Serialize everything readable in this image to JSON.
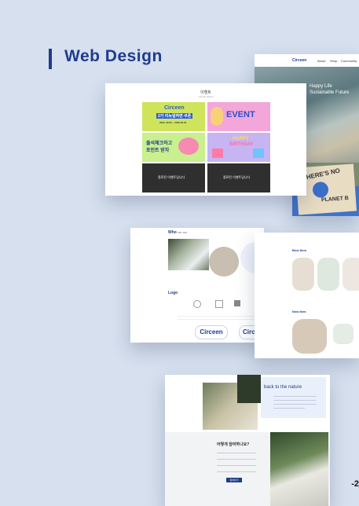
{
  "header": {
    "title": "Web Design"
  },
  "event_board": {
    "title": "이벤트",
    "subtitle": "Circeen Event",
    "tiles": [
      {
        "main": "Circeen",
        "line1": "2가 리뉴얼하면 쿠폰",
        "line2": "2022. 08.00 ~ 0000.00.00"
      },
      {
        "main": "EVENT",
        "line1": "",
        "line2": ""
      },
      {
        "main": "출석체크하고",
        "line1": "포인트 받자",
        "line2": ""
      },
      {
        "main": "HAPPY",
        "line1": "BIRTHDAY",
        "line2": ""
      },
      {
        "main": "종료된 이벤트입니다",
        "line1": "",
        "line2": ""
      },
      {
        "main": "종료된 이벤트입니다",
        "line1": "",
        "line2": ""
      }
    ]
  },
  "hero": {
    "nav_logo": "Circeen",
    "nav_items": [
      "About",
      "Shop",
      "Community"
    ],
    "text_lines": [
      "Happy Life",
      "Sustainable Future"
    ]
  },
  "who": {
    "heading": "Who",
    "heading_suffix": "we are",
    "logo_heading": "Logo",
    "logo_text": "Circeen",
    "steps": [
      "",
      "",
      "",
      ""
    ]
  },
  "poster": {
    "line1": "THERE'S NO",
    "line2": "PLANET B"
  },
  "bestnew": {
    "best_label": "Best Item",
    "new_label": "New Item"
  },
  "nature": {
    "heading": "back to the nature",
    "question": "어떻게 참여하나요?",
    "button": "참여하기"
  },
  "page": {
    "number": "-2"
  },
  "colors": {
    "accent": "#1f3c8c",
    "bg": "#d6e0ee"
  }
}
